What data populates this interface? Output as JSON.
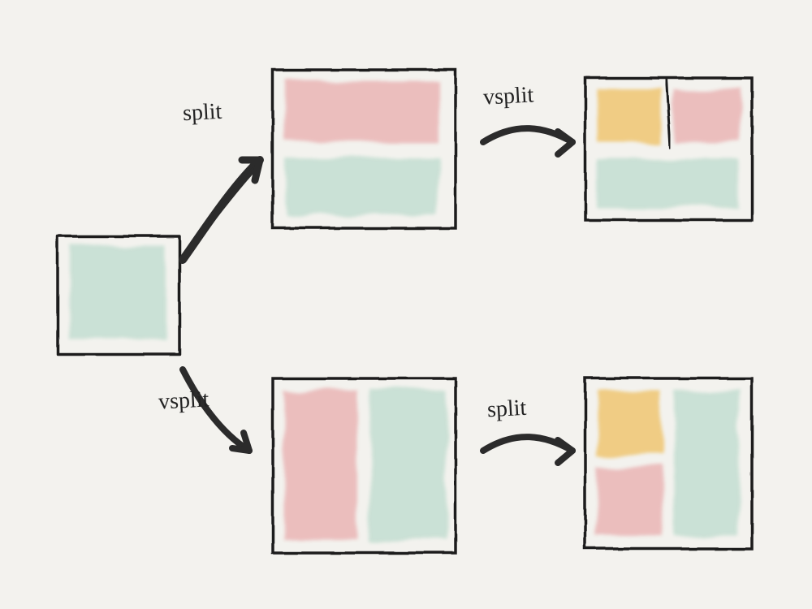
{
  "labels": {
    "split1": "split",
    "vsplit1": "vsplit",
    "vsplit2": "vsplit",
    "split2": "split"
  },
  "diagram": {
    "description": "Hand-drawn diagram of window splitting. A single window either split (horizontal) then vsplit (vertical) — or vsplit then split — yielding two different 3-pane layouts.",
    "colors": {
      "window_a": "#bedbce",
      "window_b": "#e9b2b2",
      "window_c": "#efc36a",
      "stroke": "#1f1f1f"
    },
    "nodes": [
      {
        "id": "start",
        "panes": 1,
        "layout": "single",
        "colors": [
          "window_a"
        ]
      },
      {
        "id": "top_mid",
        "panes": 2,
        "layout": "horizontal (top/bottom)",
        "colors": [
          "window_b",
          "window_a"
        ]
      },
      {
        "id": "top_end",
        "panes": 3,
        "layout": "top split L/R, bottom full",
        "colors": [
          "window_c",
          "window_b",
          "window_a"
        ]
      },
      {
        "id": "bot_mid",
        "panes": 2,
        "layout": "vertical (left/right)",
        "colors": [
          "window_b",
          "window_a"
        ]
      },
      {
        "id": "bot_end",
        "panes": 3,
        "layout": "left split top/bottom, right full",
        "colors": [
          "window_c",
          "window_b",
          "window_a"
        ]
      }
    ],
    "edges": [
      {
        "from": "start",
        "to": "top_mid",
        "action": "split"
      },
      {
        "from": "top_mid",
        "to": "top_end",
        "action": "vsplit"
      },
      {
        "from": "start",
        "to": "bot_mid",
        "action": "vsplit"
      },
      {
        "from": "bot_mid",
        "to": "bot_end",
        "action": "split"
      }
    ]
  }
}
